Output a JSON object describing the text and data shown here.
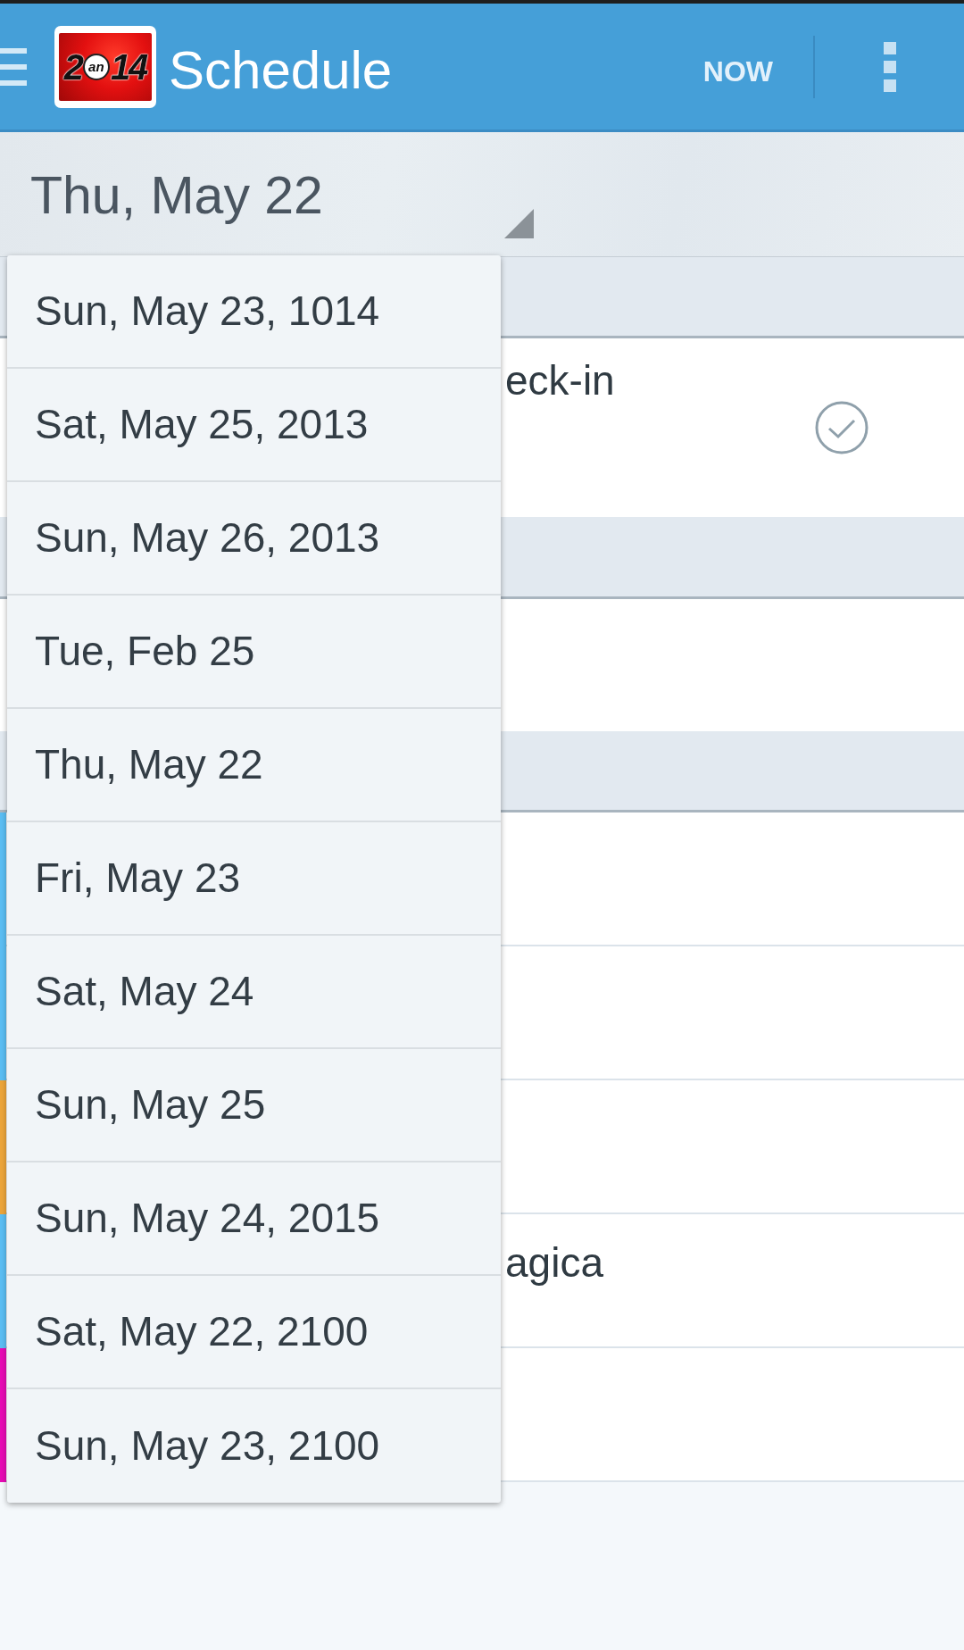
{
  "action_bar": {
    "logo": {
      "parts": [
        {
          "kind": "digits",
          "text": "2"
        },
        {
          "kind": "badge",
          "text": "an"
        },
        {
          "kind": "digits",
          "text": "14"
        }
      ]
    },
    "title": "Schedule",
    "actions": [
      {
        "kind": "text",
        "label": "NOW"
      },
      {
        "kind": "overflow"
      }
    ]
  },
  "date_spinner": {
    "value": "Thu, May 22"
  },
  "dropdown": {
    "items": [
      "Sun, May 23, 1014",
      "Sat, May 25, 2013",
      "Sun, May 26, 2013",
      "Tue, Feb 25",
      "Thu, May 22",
      "Fri, May 23",
      "Sat, May 24",
      "Sun, May 25",
      "Sun, May 24, 2015",
      "Sat, May 22, 2100",
      "Sun, May 23, 2100"
    ]
  },
  "schedule": {
    "sections": [
      {
        "rows": [
          {
            "title": "eck-in",
            "check_button": true
          }
        ]
      },
      {
        "rows": [
          {}
        ]
      },
      {
        "rows": [
          {
            "color": "#5bbdf2"
          },
          {
            "color": "#5bbdf2"
          },
          {
            "color": "#eba43a"
          },
          {
            "color": "#5bbdf2",
            "title": "agica"
          },
          {
            "color": "#e60cb4"
          }
        ]
      }
    ]
  }
}
